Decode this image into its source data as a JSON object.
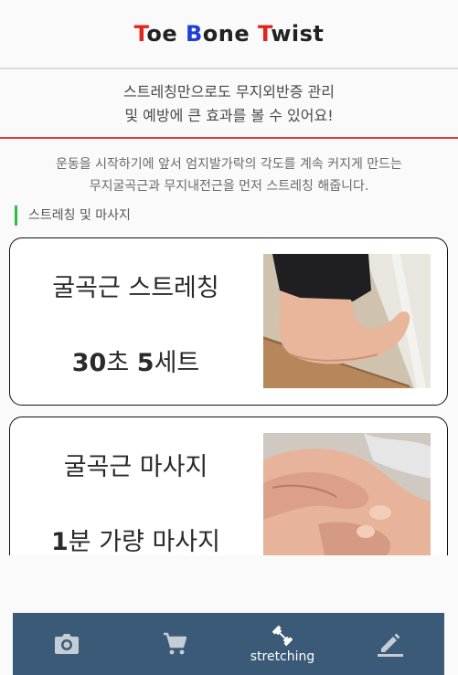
{
  "header": {
    "title_parts": [
      "T",
      "oe ",
      "B",
      "one ",
      "T",
      "wist"
    ]
  },
  "banner": {
    "line1": "스트레칭만으로도 무지외반증 관리",
    "line2": "및 예방에 큰 효과를 볼 수 있어요!"
  },
  "intro": {
    "line1": "운동을 시작하기에 앞서 엄지발가락의 각도를 계속 커지게 만드는",
    "line2": "무지굴곡근과 무지내전근을 먼저 스트레칭 해줍니다."
  },
  "section_label": "스트레칭 및 마사지",
  "cards": [
    {
      "title": "굴곡근 스트레칭",
      "sub_num": "30",
      "sub_a": "초 ",
      "sub_num2": "5",
      "sub_b": "세트"
    },
    {
      "title": "굴곡근 마사지",
      "sub_num": "1",
      "sub_a": "분 가량 마사지",
      "sub_num2": "",
      "sub_b": ""
    }
  ],
  "nav": {
    "items": [
      {
        "icon": "camera-icon",
        "label": ""
      },
      {
        "icon": "cart-icon",
        "label": ""
      },
      {
        "icon": "dumbbell-icon",
        "label": "stretching"
      },
      {
        "icon": "pencil-icon",
        "label": ""
      }
    ],
    "active_index": 2
  },
  "colors": {
    "title_red": "#e3231f",
    "title_blue": "#1f3fd8",
    "banner_rule": "#e33a2e",
    "section_bar": "#2bbf43",
    "nav_bg": "#3b5a78"
  }
}
